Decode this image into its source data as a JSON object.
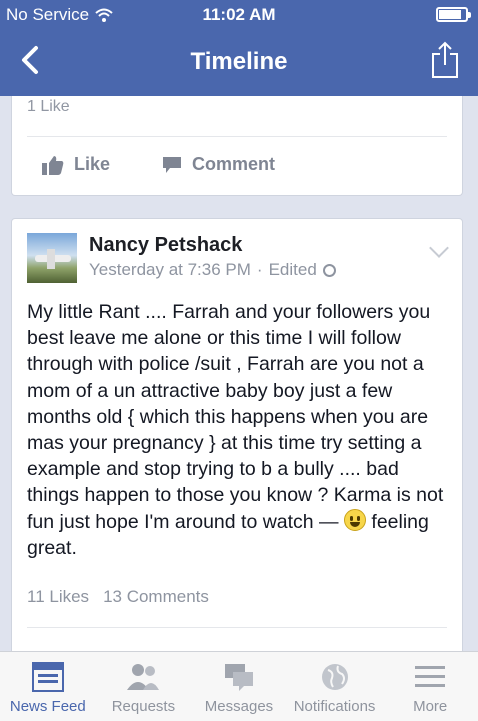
{
  "status_bar": {
    "carrier": "No Service",
    "time": "11:02 AM"
  },
  "nav": {
    "title": "Timeline"
  },
  "previous_post": {
    "likes": "1 Like",
    "like_label": "Like",
    "comment_label": "Comment"
  },
  "post": {
    "author": "Nancy Petshack",
    "timestamp": "Yesterday at 7:36 PM",
    "separator": "·",
    "edited": "Edited",
    "body": "My little Rant .... Farrah and your followers you best leave me alone or this time I will follow through with police /suit  , Farrah are you not a mom of a un attractive baby  boy just a few months old { which this happens when you are mas your pregnancy } at this time try setting a example and stop trying to b a bully .... bad things happen to those you know ? Karma is not fun just hope I'm around to watch —",
    "feeling": "feeling great.",
    "likes": "11 Likes",
    "comments": "13 Comments"
  },
  "tabs": [
    {
      "label": "News Feed",
      "icon": "news-feed-icon",
      "active": true
    },
    {
      "label": "Requests",
      "icon": "friend-requests-icon"
    },
    {
      "label": "Messages",
      "icon": "messages-icon"
    },
    {
      "label": "Notifications",
      "icon": "globe-icon"
    },
    {
      "label": "More",
      "icon": "menu-icon"
    }
  ],
  "colors": {
    "brand": "#4a67ad",
    "background": "#dfe3ee",
    "muted_text": "#8e94a0"
  }
}
